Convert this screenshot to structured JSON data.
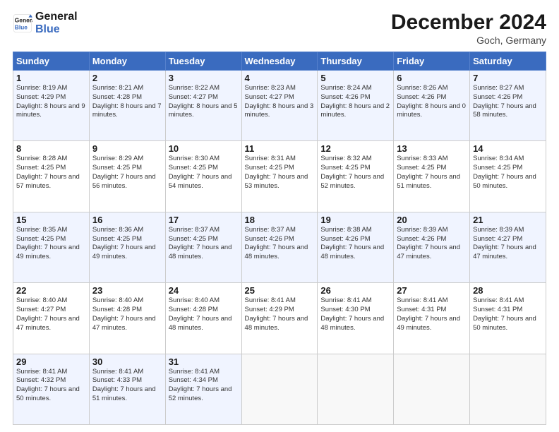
{
  "logo": {
    "line1": "General",
    "line2": "Blue"
  },
  "title": "December 2024",
  "location": "Goch, Germany",
  "days_of_week": [
    "Sunday",
    "Monday",
    "Tuesday",
    "Wednesday",
    "Thursday",
    "Friday",
    "Saturday"
  ],
  "weeks": [
    [
      {
        "num": "1",
        "sunrise": "8:19 AM",
        "sunset": "4:29 PM",
        "daylight": "8 hours and 9 minutes."
      },
      {
        "num": "2",
        "sunrise": "8:21 AM",
        "sunset": "4:28 PM",
        "daylight": "8 hours and 7 minutes."
      },
      {
        "num": "3",
        "sunrise": "8:22 AM",
        "sunset": "4:27 PM",
        "daylight": "8 hours and 5 minutes."
      },
      {
        "num": "4",
        "sunrise": "8:23 AM",
        "sunset": "4:27 PM",
        "daylight": "8 hours and 3 minutes."
      },
      {
        "num": "5",
        "sunrise": "8:24 AM",
        "sunset": "4:26 PM",
        "daylight": "8 hours and 2 minutes."
      },
      {
        "num": "6",
        "sunrise": "8:26 AM",
        "sunset": "4:26 PM",
        "daylight": "8 hours and 0 minutes."
      },
      {
        "num": "7",
        "sunrise": "8:27 AM",
        "sunset": "4:26 PM",
        "daylight": "7 hours and 58 minutes."
      }
    ],
    [
      {
        "num": "8",
        "sunrise": "8:28 AM",
        "sunset": "4:25 PM",
        "daylight": "7 hours and 57 minutes."
      },
      {
        "num": "9",
        "sunrise": "8:29 AM",
        "sunset": "4:25 PM",
        "daylight": "7 hours and 56 minutes."
      },
      {
        "num": "10",
        "sunrise": "8:30 AM",
        "sunset": "4:25 PM",
        "daylight": "7 hours and 54 minutes."
      },
      {
        "num": "11",
        "sunrise": "8:31 AM",
        "sunset": "4:25 PM",
        "daylight": "7 hours and 53 minutes."
      },
      {
        "num": "12",
        "sunrise": "8:32 AM",
        "sunset": "4:25 PM",
        "daylight": "7 hours and 52 minutes."
      },
      {
        "num": "13",
        "sunrise": "8:33 AM",
        "sunset": "4:25 PM",
        "daylight": "7 hours and 51 minutes."
      },
      {
        "num": "14",
        "sunrise": "8:34 AM",
        "sunset": "4:25 PM",
        "daylight": "7 hours and 50 minutes."
      }
    ],
    [
      {
        "num": "15",
        "sunrise": "8:35 AM",
        "sunset": "4:25 PM",
        "daylight": "7 hours and 49 minutes."
      },
      {
        "num": "16",
        "sunrise": "8:36 AM",
        "sunset": "4:25 PM",
        "daylight": "7 hours and 49 minutes."
      },
      {
        "num": "17",
        "sunrise": "8:37 AM",
        "sunset": "4:25 PM",
        "daylight": "7 hours and 48 minutes."
      },
      {
        "num": "18",
        "sunrise": "8:37 AM",
        "sunset": "4:26 PM",
        "daylight": "7 hours and 48 minutes."
      },
      {
        "num": "19",
        "sunrise": "8:38 AM",
        "sunset": "4:26 PM",
        "daylight": "7 hours and 48 minutes."
      },
      {
        "num": "20",
        "sunrise": "8:39 AM",
        "sunset": "4:26 PM",
        "daylight": "7 hours and 47 minutes."
      },
      {
        "num": "21",
        "sunrise": "8:39 AM",
        "sunset": "4:27 PM",
        "daylight": "7 hours and 47 minutes."
      }
    ],
    [
      {
        "num": "22",
        "sunrise": "8:40 AM",
        "sunset": "4:27 PM",
        "daylight": "7 hours and 47 minutes."
      },
      {
        "num": "23",
        "sunrise": "8:40 AM",
        "sunset": "4:28 PM",
        "daylight": "7 hours and 47 minutes."
      },
      {
        "num": "24",
        "sunrise": "8:40 AM",
        "sunset": "4:28 PM",
        "daylight": "7 hours and 48 minutes."
      },
      {
        "num": "25",
        "sunrise": "8:41 AM",
        "sunset": "4:29 PM",
        "daylight": "7 hours and 48 minutes."
      },
      {
        "num": "26",
        "sunrise": "8:41 AM",
        "sunset": "4:30 PM",
        "daylight": "7 hours and 48 minutes."
      },
      {
        "num": "27",
        "sunrise": "8:41 AM",
        "sunset": "4:31 PM",
        "daylight": "7 hours and 49 minutes."
      },
      {
        "num": "28",
        "sunrise": "8:41 AM",
        "sunset": "4:31 PM",
        "daylight": "7 hours and 50 minutes."
      }
    ],
    [
      {
        "num": "29",
        "sunrise": "8:41 AM",
        "sunset": "4:32 PM",
        "daylight": "7 hours and 50 minutes."
      },
      {
        "num": "30",
        "sunrise": "8:41 AM",
        "sunset": "4:33 PM",
        "daylight": "7 hours and 51 minutes."
      },
      {
        "num": "31",
        "sunrise": "8:41 AM",
        "sunset": "4:34 PM",
        "daylight": "7 hours and 52 minutes."
      },
      null,
      null,
      null,
      null
    ]
  ],
  "labels": {
    "sunrise": "Sunrise:",
    "sunset": "Sunset:",
    "daylight": "Daylight:"
  }
}
